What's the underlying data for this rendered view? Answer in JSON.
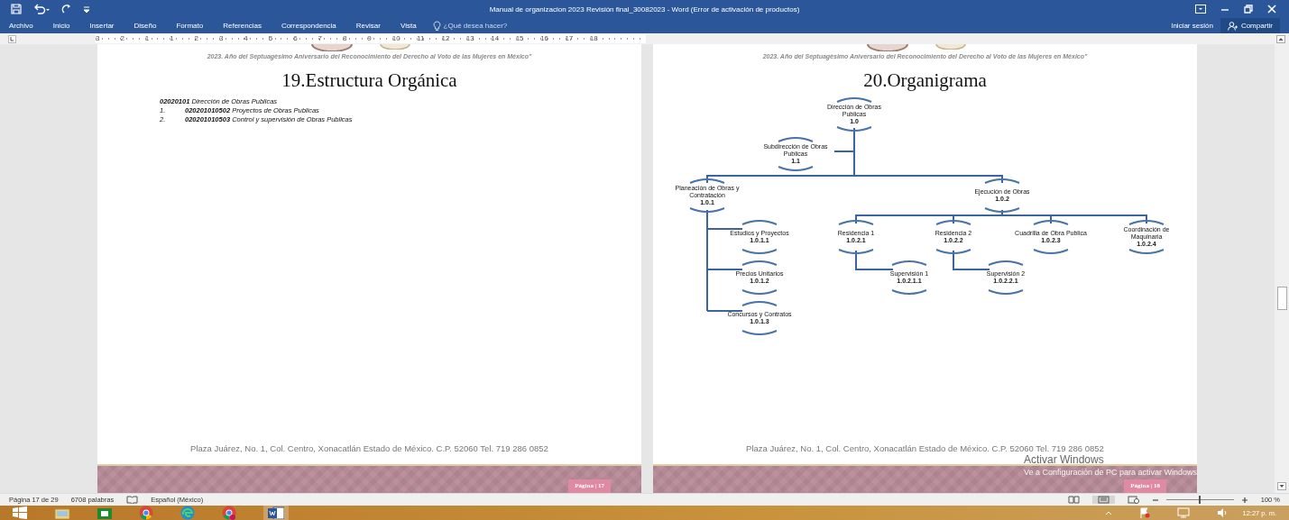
{
  "window": {
    "title": "Manual de organizacion 2023 Revisión final_30082023 - Word (Error de activación de productos)"
  },
  "ribbon": {
    "tabs": [
      {
        "label": "Archivo",
        "selected": false
      },
      {
        "label": "Inicio",
        "selected": false
      },
      {
        "label": "Insertar",
        "selected": false
      },
      {
        "label": "Diseño",
        "selected": false
      },
      {
        "label": "Formato",
        "selected": false
      },
      {
        "label": "Referencias",
        "selected": false
      },
      {
        "label": "Correspondencia",
        "selected": false
      },
      {
        "label": "Revisar",
        "selected": false
      },
      {
        "label": "Vista",
        "selected": false
      }
    ],
    "search": {
      "placeholder": "¿Qué desea hacer?"
    },
    "sign_in": "Iniciar sesión",
    "share": "Compartir"
  },
  "ruler": {
    "labels": [
      "3",
      "2",
      "1",
      "1",
      "2",
      "3",
      "4",
      "5",
      "6",
      "7",
      "8",
      "9",
      "10",
      "11",
      "12",
      "13",
      "14",
      "15",
      "16",
      "17",
      "18"
    ]
  },
  "pages": [
    {
      "kind": "text",
      "motto": "2023. Año del Septuagésimo Aniversario del Reconocimiento del Derecho al Voto de las Mujeres en México\"",
      "heading": "19.Estructura Orgánica",
      "intro": "**02020101** Dirección de Obras Publicas",
      "items": [
        {
          "number": "1.",
          "text": "**020201010502** Proyectos de Obras Publicas"
        },
        {
          "number": "2.",
          "text": "**020201010503** Control y supervisión de Obras Publicas"
        }
      ],
      "footer": "Plaza Juárez, No. 1, Col. Centro, Xonacatlán Estado de México. C.P. 52060 Tel. 719 286 0852",
      "page_label": "Página | 17"
    },
    {
      "kind": "chart",
      "motto": "2023. Año del Septuagésimo Aniversario del Reconocimiento del Derecho al Voto de las Mujeres en México\"",
      "heading": "20.Organigrama",
      "org": {
        "lines": [
          "Dirección de Obras",
          "Publicas"
        ],
        "code": "1.0",
        "children": [
          {
            "lines": [
              "Subdirección de Obras",
              "Publicas"
            ],
            "code": "1.1"
          },
          {
            "lines": [
              "Planeación de Obras y",
              "Contratación"
            ],
            "code": "1.0.1",
            "children": [
              {
                "lines": [
                  "Estudios y Proyectos"
                ],
                "code": "1.0.1.1"
              },
              {
                "lines": [
                  "Precios Unitarios"
                ],
                "code": "1.0.1.2"
              },
              {
                "lines": [
                  "Concursos y Contratos"
                ],
                "code": "1.0.1.3"
              }
            ]
          },
          {
            "lines": [
              "Ejecución de Obras"
            ],
            "code": "1.0.2",
            "children": [
              {
                "lines": [
                  "Residencia 1"
                ],
                "code": "1.0.2.1",
                "children": [
                  {
                    "lines": [
                      "Supervisión 1"
                    ],
                    "code": "1.0.2.1.1"
                  }
                ]
              },
              {
                "lines": [
                  "Residencia 2"
                ],
                "code": "1.0.2.2",
                "children": [
                  {
                    "lines": [
                      "Supervisión 2"
                    ],
                    "code": "1.0.2.2.1"
                  }
                ]
              },
              {
                "lines": [
                  "Cuadrilla de Obra Publica"
                ],
                "code": "1.0.2.3"
              },
              {
                "lines": [
                  "Coordinación de",
                  "Maquinaria"
                ],
                "code": "1.0.2.4"
              }
            ]
          }
        ]
      },
      "footer": "Plaza Juárez, No. 1, Col. Centro, Xonacatlán Estado de México. C.P. 52060 Tel. 719 286 0852",
      "page_label": "Página | 18"
    }
  ],
  "activation_notice": {
    "title": "Activar Windows",
    "text": "Ve a Configuración de PC para activar Windows."
  },
  "status_bar": {
    "page": "Página 17 de 29",
    "words": "6708 palabras",
    "language": "Español (México)",
    "zoom": {
      "level": 0.5,
      "reading": "100 %"
    }
  },
  "taskbar": {
    "clock": "12:27 p. m."
  }
}
